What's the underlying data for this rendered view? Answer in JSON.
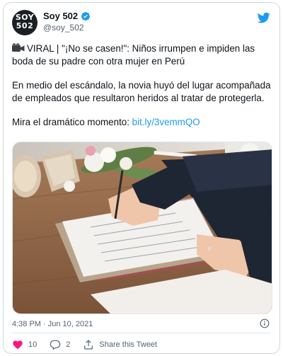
{
  "tweet": {
    "author": {
      "display_name": "Soy 502",
      "handle": "@soy_502",
      "avatar_text_line1": "SOY",
      "avatar_text_line2": "502",
      "verified": true
    },
    "text": {
      "headline": "VIRAL | \"¡No se casen!\": Niños irrumpen e impiden las boda de su padre con otra mujer en Perú",
      "paragraph": "En medio del escándalo, la novia huyó del lugar acompañada de empleados que resultaron heridos al tratar de protegerla.",
      "cta_prefix": "Mira el dramático momento: ",
      "cta_link": "bit.ly/3vemmQO"
    },
    "timestamp": "4:38 PM · Jun 10, 2021",
    "actions": {
      "likes_count": "10",
      "replies_count": "2",
      "share_label": "Share this Tweet"
    },
    "colors": {
      "link": "#1d9bf0",
      "like": "#f91880",
      "twitter_blue": "#1d9bf0",
      "muted": "#536471"
    },
    "icons": {
      "brand": "twitter-bird-icon",
      "verified": "verified-badge-icon",
      "camera": "movie-camera-icon",
      "info": "info-icon",
      "like": "heart-icon",
      "reply": "reply-bubble-icon",
      "share": "share-upload-icon"
    }
  }
}
